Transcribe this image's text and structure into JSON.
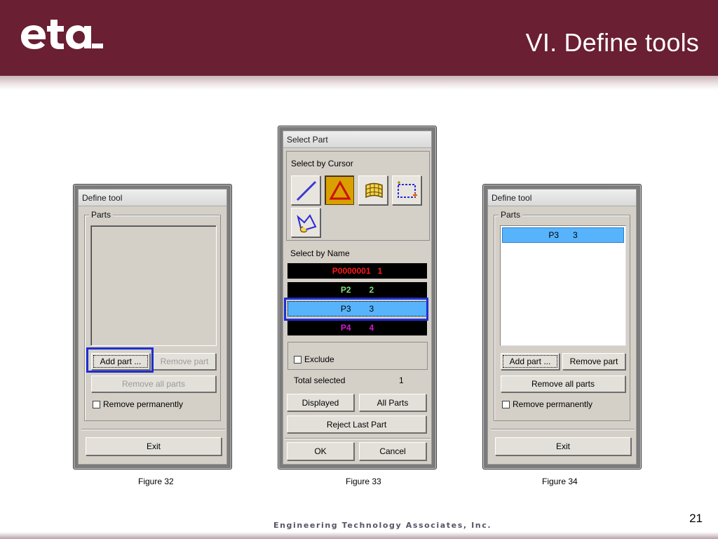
{
  "header": {
    "title": "VI.  Define tools"
  },
  "footer": {
    "company": "Engineering Technology Associates, Inc.",
    "page_number": "21"
  },
  "figures": {
    "fig32": {
      "caption": "Figure 32"
    },
    "fig33": {
      "caption": "Figure 33"
    },
    "fig34": {
      "caption": "Figure 34"
    }
  },
  "define_tool_empty": {
    "title": "Define tool",
    "parts_group": "Parts",
    "add_part": "Add part ...",
    "remove_part": "Remove part",
    "remove_all_parts": "Remove all parts",
    "remove_permanently": "Remove permanently",
    "exit": "Exit"
  },
  "select_part": {
    "title": "Select Part",
    "select_by_cursor": "Select by Cursor",
    "select_by_name": "Select by Name",
    "tool_icons": [
      "line-select-icon",
      "triangle-select-icon",
      "surface-select-icon",
      "box-select-icon",
      "polygon-select-icon"
    ],
    "parts": [
      {
        "name": "P0000001",
        "id": "1",
        "color": "#ff1a1a"
      },
      {
        "name": "P2",
        "id": "2",
        "color": "#7fe07f"
      },
      {
        "name": "P3",
        "id": "3",
        "color": "#000000"
      },
      {
        "name": "P4",
        "id": "4",
        "color": "#d11ad1"
      }
    ],
    "exclude": "Exclude",
    "total_selected_label": "Total selected",
    "total_selected_value": "1",
    "displayed": "Displayed",
    "all_parts": "All Parts",
    "reject_last_part": "Reject Last Part",
    "ok": "OK",
    "cancel": "Cancel"
  },
  "define_tool_filled": {
    "title": "Define tool",
    "parts_group": "Parts",
    "selected_part": {
      "name": "P3",
      "id": "3"
    },
    "add_part": "Add part ...",
    "remove_part": "Remove part",
    "remove_all_parts": "Remove all parts",
    "remove_permanently": "Remove permanently",
    "exit": "Exit"
  },
  "colors": {
    "header_bg": "#6a1f32",
    "selection_blue": "#57b3fb",
    "highlight_border": "#1f2fd0",
    "tool_active": "#d9a000"
  }
}
